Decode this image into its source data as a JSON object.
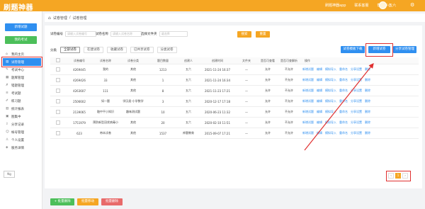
{
  "header": {
    "logo": "刷题神器",
    "nav": [
      "刷题神器app",
      "联系客服",
      "帮助中心"
    ],
    "username": "五六"
  },
  "sidebar": {
    "primary_btn": "新增试题",
    "secondary_btn": "我的考试",
    "items": [
      {
        "label": "我的主页",
        "icon": "home-icon"
      },
      {
        "label": "试卷管理",
        "icon": "doc-icon",
        "active": true
      },
      {
        "label": "考试中心",
        "icon": "exam-icon"
      },
      {
        "label": "题库管理",
        "icon": "bank-icon"
      },
      {
        "label": "错题管理",
        "icon": "wrong-icon"
      },
      {
        "label": "考试题",
        "icon": "list-icon"
      },
      {
        "label": "练习题",
        "icon": "practice-icon"
      },
      {
        "label": "统计报表",
        "icon": "stats-icon"
      },
      {
        "label": "图集中",
        "icon": "image-icon"
      },
      {
        "label": "分享记录",
        "icon": "share-icon"
      },
      {
        "label": "帐号管理",
        "icon": "account-icon"
      },
      {
        "label": "个人设置",
        "icon": "user-icon"
      },
      {
        "label": "服务详情",
        "icon": "service-icon"
      }
    ],
    "footer": "Ng"
  },
  "breadcrumb": {
    "items": [
      "试卷管理",
      "试卷管理"
    ]
  },
  "filters": {
    "code_label": "试卷编号",
    "code_placeholder": "请输入试卷编号",
    "name_label": "试卷名称",
    "name_placeholder": "请输入试卷名称",
    "folder_label": "选择文件夹",
    "folder_placeholder": "请选择",
    "search_btn": "搜索",
    "reset_btn": "重置"
  },
  "tabs": {
    "label": "分类",
    "items": [
      "全部试卷",
      "在建试卷",
      "收藏试卷",
      "已共享试卷",
      "分类试卷"
    ]
  },
  "actions": {
    "template_btn": "试卷模板下载",
    "new_btn": "新增试卷",
    "share_btn": "分享试卷管理"
  },
  "table": {
    "columns": [
      "",
      "试卷编号",
      "试卷名称",
      "试卷分类",
      "题目数量",
      "创建人",
      "创建时间",
      "文件夹",
      "是否可查看",
      "是否可查解析",
      "操作"
    ],
    "rows": [
      {
        "code": "4269445",
        "name": "我的",
        "category": "其他",
        "count": "1213",
        "creator": "五六",
        "time": "2021-11-24 16:37",
        "folder": "—",
        "view": "允许",
        "analysis": "不允许"
      },
      {
        "code": "4269426",
        "name": "33",
        "category": "其他",
        "count": "1",
        "creator": "五六",
        "time": "2021-11-24 16:34",
        "folder": "—",
        "view": "允许",
        "analysis": "不允许"
      },
      {
        "code": "4263607",
        "name": "111",
        "category": "其他",
        "count": "8",
        "creator": "五六",
        "time": "2021-11-23 17:21",
        "folder": "—",
        "view": "允许",
        "analysis": "不允许"
      },
      {
        "code": "2506602",
        "name": "如一题",
        "category": "学历类-小学数学",
        "count": "3",
        "creator": "五六",
        "time": "2020-12-17 17:18",
        "folder": "—",
        "view": "允许",
        "analysis": "不允许"
      },
      {
        "code": "2139065",
        "name": "融中平小知识",
        "category": "趣味测试题",
        "count": "10",
        "creator": "五六",
        "time": "2020-06-23 11:32",
        "folder": "—",
        "view": "允许",
        "analysis": "不允许"
      },
      {
        "code": "1751979",
        "name": "预防新型冠状病毒小知识",
        "category": "其他",
        "count": "20",
        "creator": "五六",
        "time": "2020-02-10 11:51",
        "folder": "—",
        "view": "允许",
        "analysis": "不允许"
      },
      {
        "code": "623",
        "name": "带本试卷",
        "category": "其他",
        "count": "1537",
        "creator": "库题教育",
        "time": "2015-09-07 17:21",
        "folder": "—",
        "view": "允许",
        "analysis": "不允许"
      }
    ],
    "ops": [
      "新增试题",
      "编辑",
      "模拟导入",
      "重命名",
      "分享设置",
      "删除"
    ]
  },
  "footer": {
    "btn1": "+ 批量删除",
    "btn2": "批量移动",
    "btn3": "批量删除",
    "pages": [
      "1"
    ]
  },
  "colors": {
    "orange": "#f5a623",
    "blue": "#2f8ff0",
    "green": "#4cbf5a",
    "red": "#e03030"
  }
}
